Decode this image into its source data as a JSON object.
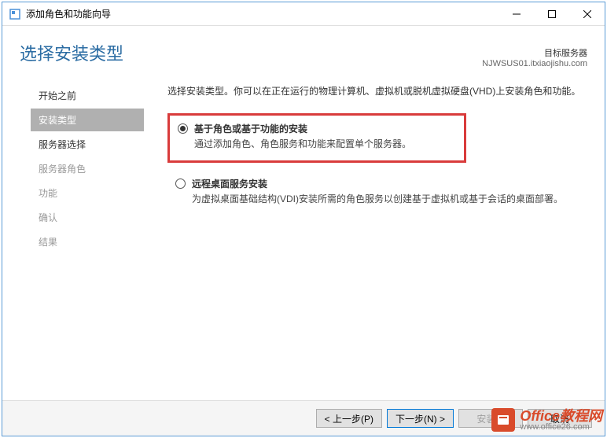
{
  "titlebar": {
    "title": "添加角色和功能向导"
  },
  "header": {
    "heading": "选择安装类型",
    "server_label": "目标服务器",
    "server_value": "NJWSUS01.itxiaojishu.com"
  },
  "sidebar": {
    "items": [
      {
        "label": "开始之前",
        "state": "enabled"
      },
      {
        "label": "安装类型",
        "state": "active"
      },
      {
        "label": "服务器选择",
        "state": "enabled"
      },
      {
        "label": "服务器角色",
        "state": "disabled"
      },
      {
        "label": "功能",
        "state": "disabled"
      },
      {
        "label": "确认",
        "state": "disabled"
      },
      {
        "label": "结果",
        "state": "disabled"
      }
    ]
  },
  "panel": {
    "intro": "选择安装类型。你可以在正在运行的物理计算机、虚拟机或脱机虚拟硬盘(VHD)上安装角色和功能。",
    "option1": {
      "title": "基于角色或基于功能的安装",
      "desc": "通过添加角色、角色服务和功能来配置单个服务器。"
    },
    "option2": {
      "title": "远程桌面服务安装",
      "desc": "为虚拟桌面基础结构(VDI)安装所需的角色服务以创建基于虚拟机或基于会话的桌面部署。"
    }
  },
  "footer": {
    "prev": "< 上一步(P)",
    "next": "下一步(N) >",
    "install": "安装(I)",
    "cancel": "取消"
  },
  "watermark": {
    "line1": "Office教程网",
    "line2": "www.office26.com"
  }
}
